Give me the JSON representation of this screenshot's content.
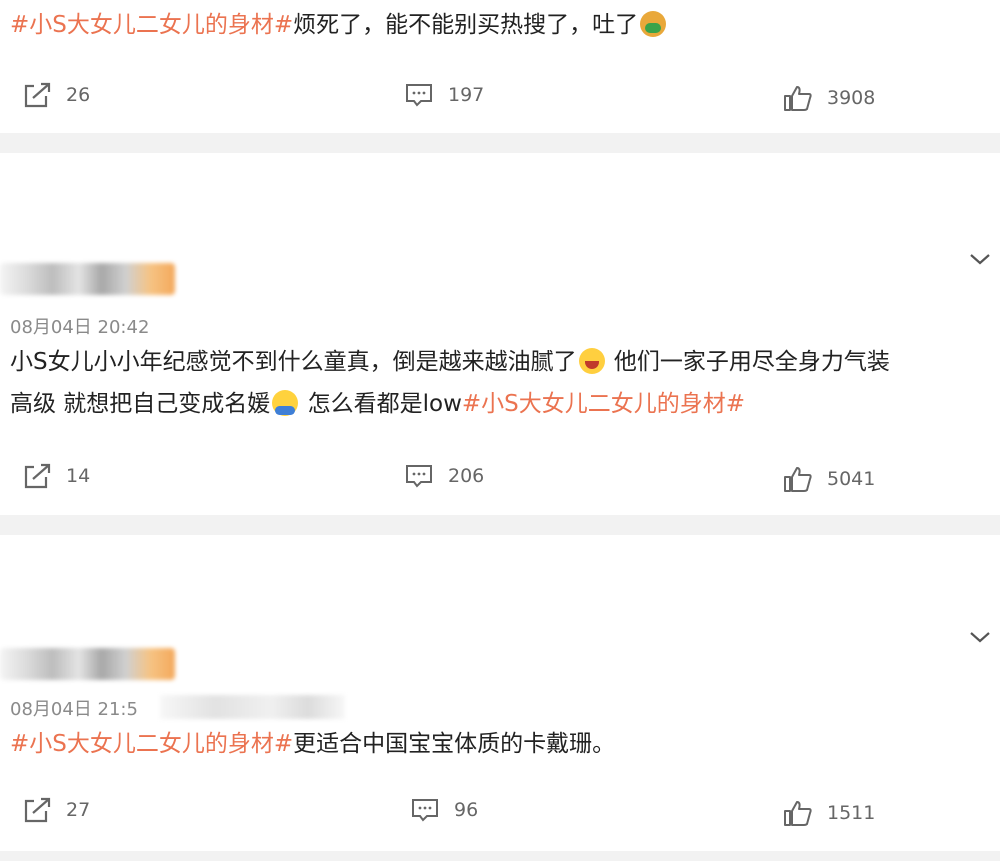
{
  "posts": [
    {
      "text_parts": [
        "#小S大女儿二女儿的身材#",
        "烦死了，能不能别买热搜了，吐了"
      ],
      "actions": {
        "repost": "26",
        "comment": "197",
        "like": "3908"
      }
    },
    {
      "time": "08月04日 20:42",
      "line1": "小S女儿小小年纪感觉不到什么童真，倒是越来越油腻了",
      "line1b": " 他们一家子用尽全身力气装",
      "line2a": "高级 就想把自己变成名媛",
      "line2b": " 怎么看都是low",
      "line2_tag": "#小S大女儿二女儿的身材#",
      "actions": {
        "repost": "14",
        "comment": "206",
        "like": "5041"
      }
    },
    {
      "time": "08月04日 21:5",
      "text_parts": [
        "#小S大女儿二女儿的身材#",
        "更适合中国宝宝体质的卡戴珊。"
      ],
      "actions": {
        "repost": "27",
        "comment": "96",
        "like": "1511"
      }
    }
  ],
  "colors": {
    "topic": "#eb7350",
    "background": "#f2f2f2",
    "card": "#ffffff",
    "meta": "#8a8a8a"
  },
  "icons": [
    "repost-icon",
    "comment-icon",
    "like-icon",
    "chevron-down-icon",
    "emoji-sick",
    "emoji-laugh",
    "emoji-hug"
  ]
}
